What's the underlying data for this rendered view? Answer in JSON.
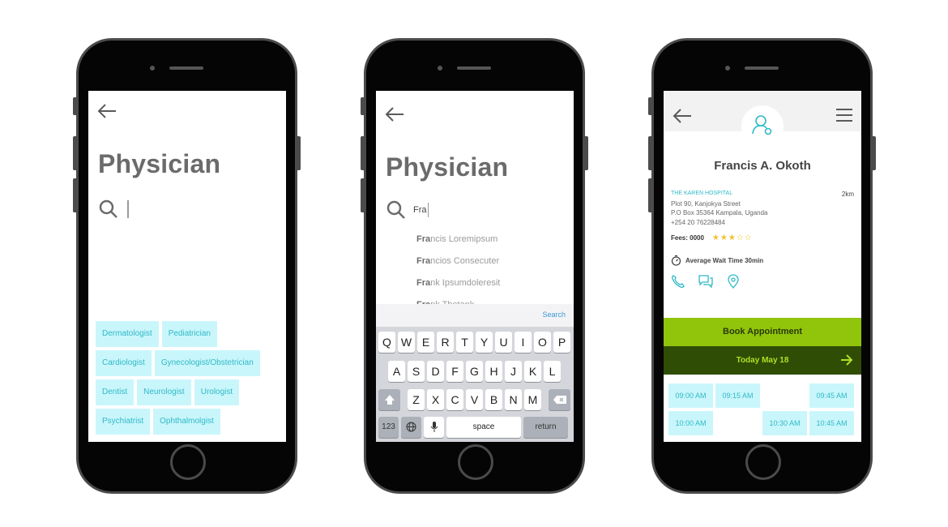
{
  "phone1": {
    "title": "Physician",
    "chips": [
      [
        "Dermatologist",
        "Pediatrician"
      ],
      [
        "Cardiologist",
        "Gynecologist/Obstetrician"
      ],
      [
        "Dentist",
        "Neurologist",
        "Urologist"
      ],
      [
        "Psychiatrist",
        "Ophthalmolgist"
      ]
    ]
  },
  "phone2": {
    "title": "Physician",
    "typed": "Fra",
    "suggestions": [
      {
        "prefix": "Fra",
        "rest": "ncis Loremipsum"
      },
      {
        "prefix": "Fra",
        "rest": "ncios Consecuter"
      },
      {
        "prefix": "Fra",
        "rest": "nk Ipsumdoleresit"
      },
      {
        "prefix": "Fra",
        "rest": "nk Thetank"
      }
    ],
    "keyboard": {
      "search_label": "Search",
      "row1": [
        "Q",
        "W",
        "E",
        "R",
        "T",
        "Y",
        "U",
        "I",
        "O",
        "P"
      ],
      "row2": [
        "A",
        "S",
        "D",
        "F",
        "G",
        "H",
        "J",
        "K",
        "L"
      ],
      "row3": [
        "Z",
        "X",
        "C",
        "V",
        "B",
        "N",
        "M"
      ],
      "numbers_label": "123",
      "space_label": "space",
      "return_label": "return"
    }
  },
  "phone3": {
    "doctor_name": "Francis A. Okoth",
    "hospital": "THE KAREN HOSPITAL",
    "distance": "2km",
    "address_lines": [
      "Plot 90, Kanjokya Street",
      "P.O Box 35364 Kampala, Uganda",
      "+254 20 76228484"
    ],
    "fees": "Fees: 0000",
    "rating": 3,
    "rating_max": 5,
    "wait_time": "Average Wait Time 30min",
    "book_label": "Book Appointment",
    "date_label": "Today May 18",
    "slots": [
      "09:00 AM",
      "09:15 AM",
      "09:45 AM",
      "10:00 AM",
      "10:30 AM",
      "10:45 AM"
    ]
  },
  "colors": {
    "chip_bg": "#c9f6fb",
    "chip_text": "#2fb9c7",
    "book_green": "#91c50b",
    "date_bar": "#2f4d05",
    "star": "#f2c02e"
  }
}
